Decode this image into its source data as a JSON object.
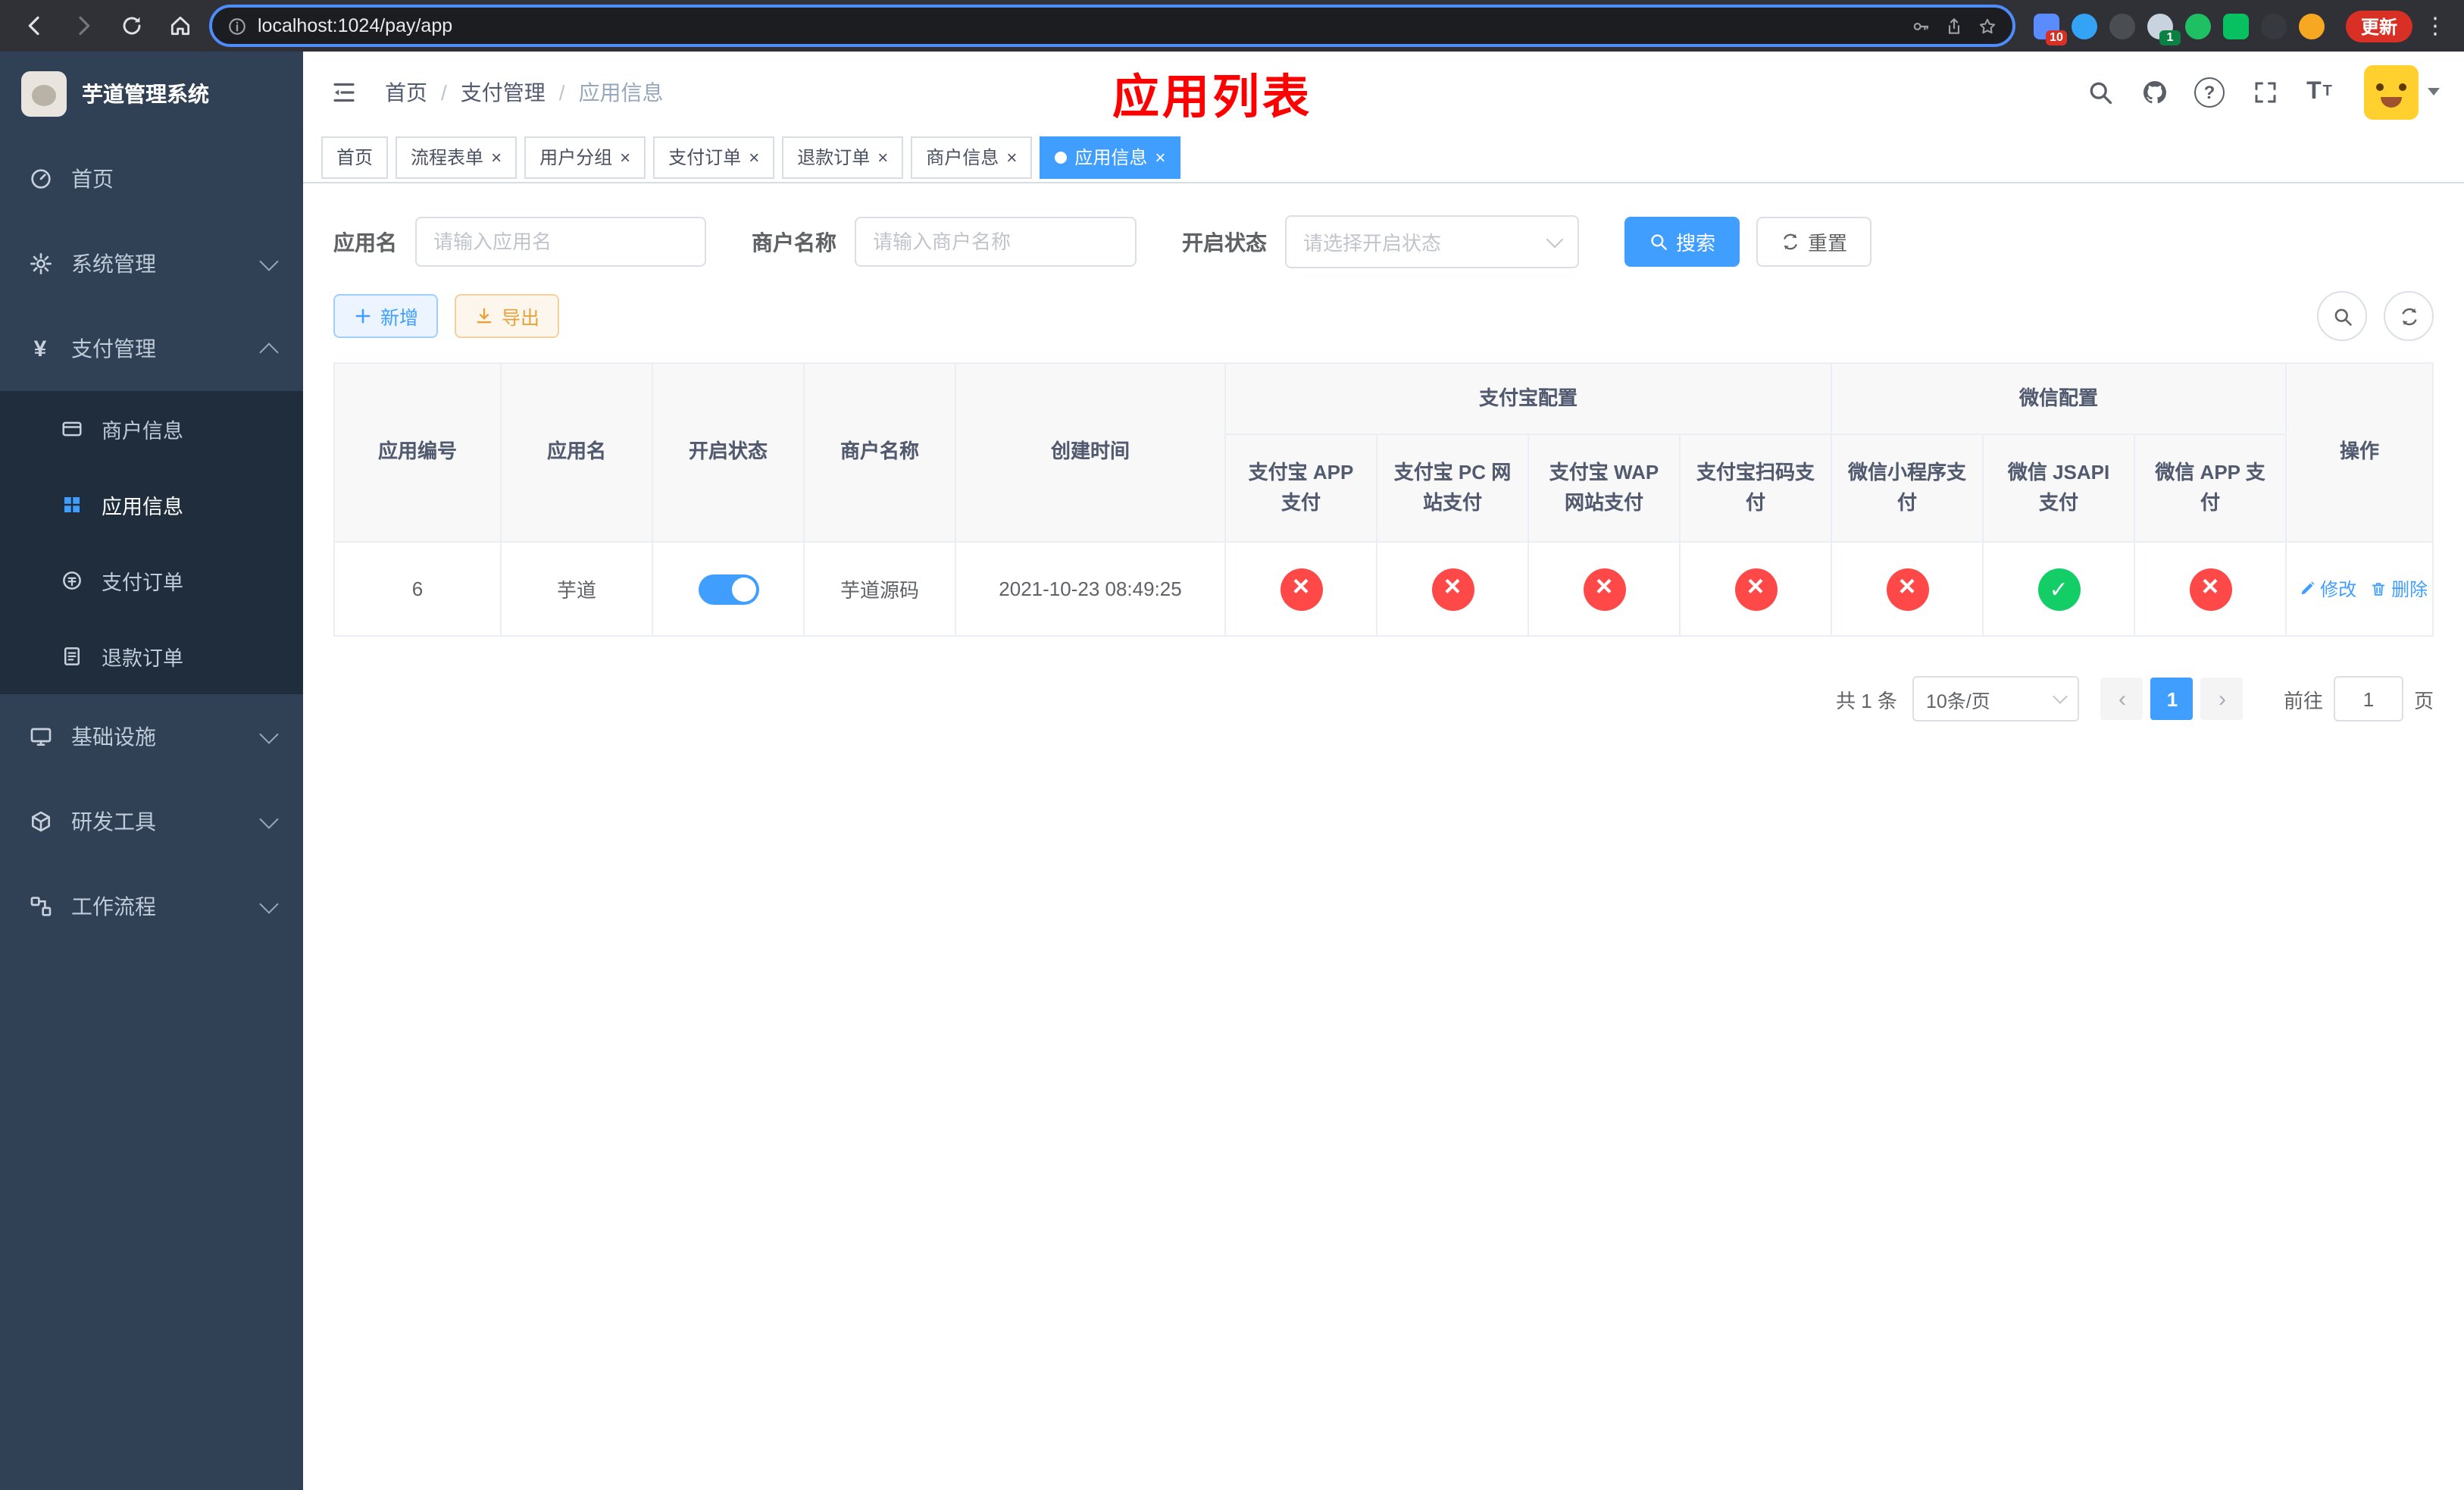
{
  "browser": {
    "url": "localhost:1024/pay/app",
    "update_button": "更新",
    "ext_badge_grid": "10",
    "ext_badge_profile": "1"
  },
  "sidebar": {
    "logo_title": "芋道管理系统",
    "items": [
      {
        "label": "首页"
      },
      {
        "label": "系统管理"
      },
      {
        "label": "支付管理",
        "children": [
          {
            "label": "商户信息"
          },
          {
            "label": "应用信息"
          },
          {
            "label": "支付订单"
          },
          {
            "label": "退款订单"
          }
        ]
      },
      {
        "label": "基础设施"
      },
      {
        "label": "研发工具"
      },
      {
        "label": "工作流程"
      }
    ]
  },
  "header": {
    "breadcrumb": [
      "首页",
      "支付管理",
      "应用信息"
    ],
    "page_title": "应用列表"
  },
  "tabs": [
    {
      "label": "首页"
    },
    {
      "label": "流程表单"
    },
    {
      "label": "用户分组"
    },
    {
      "label": "支付订单"
    },
    {
      "label": "退款订单"
    },
    {
      "label": "商户信息"
    },
    {
      "label": "应用信息"
    }
  ],
  "filters": {
    "app_name_label": "应用名",
    "app_name_placeholder": "请输入应用名",
    "merchant_label": "商户名称",
    "merchant_placeholder": "请输入商户名称",
    "status_label": "开启状态",
    "status_placeholder": "请选择开启状态",
    "search_button": "搜索",
    "reset_button": "重置"
  },
  "toolbar": {
    "add_button": "新增",
    "export_button": "导出"
  },
  "table": {
    "group_alipay": "支付宝配置",
    "group_wechat": "微信配置",
    "columns_main": [
      "应用编号",
      "应用名",
      "开启状态",
      "商户名称",
      "创建时间"
    ],
    "columns_pay": [
      "支付宝 APP 支付",
      "支付宝 PC 网站支付",
      "支付宝 WAP 网站支付",
      "支付宝扫码支付",
      "微信小程序支付",
      "微信 JSAPI 支付",
      "微信 APP 支付"
    ],
    "column_actions": "操作",
    "rows": [
      {
        "id": "6",
        "name": "芋道",
        "enabled": true,
        "merchant": "芋道源码",
        "created": "2021-10-23 08:49:25",
        "alipay_app": false,
        "alipay_pc": false,
        "alipay_wap": false,
        "alipay_qr": false,
        "wechat_mini": false,
        "wechat_jsapi": true,
        "wechat_app": false,
        "edit_label": "修改",
        "delete_label": "删除"
      }
    ]
  },
  "pagination": {
    "total": "共 1 条",
    "page_size": "10条/页",
    "current_page": "1",
    "goto_label": "前往",
    "goto_value": "1",
    "unit_label": "页"
  },
  "colors": {
    "accent": "#409eff",
    "success": "#13ce66",
    "danger": "#ff4949",
    "sidebar_bg": "#304156",
    "submenu_bg": "#1f2d3d",
    "title_red": "#ff0000"
  }
}
